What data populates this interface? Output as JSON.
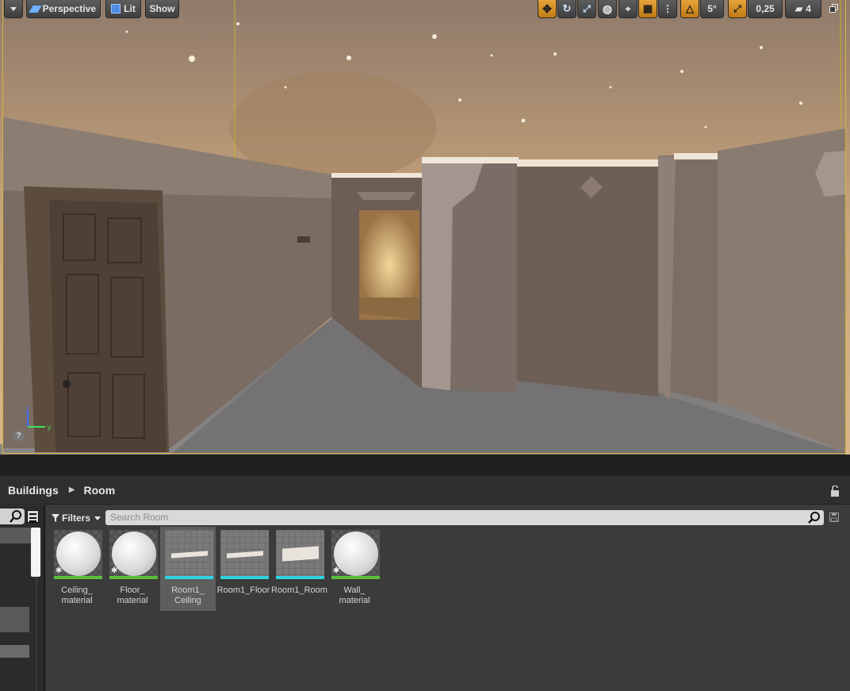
{
  "viewport": {
    "menu_button": "chevron-down",
    "view_mode": "Perspective",
    "lighting_mode": "Lit",
    "show_label": "Show",
    "rotation_snap": "5°",
    "scale_snap": "0,25",
    "camera_speed": "4",
    "axis_labels": {
      "z": "Z",
      "y": "Y"
    },
    "help_glyph": "?",
    "accent_color": "#d6a23a"
  },
  "content_browser": {
    "breadcrumb": [
      "Buildings",
      "Room"
    ],
    "filters_label": "Filters",
    "search_placeholder": "Search Room",
    "assets": [
      {
        "label": "Ceiling_\nmaterial",
        "kind": "material",
        "bar_color": "#5bbf3c",
        "selected": false
      },
      {
        "label": "Floor_\nmaterial",
        "kind": "material",
        "bar_color": "#5bbf3c",
        "selected": false
      },
      {
        "label": "Room1_\nCeiling",
        "kind": "mesh",
        "bar_color": "#2fd3e0",
        "selected": true
      },
      {
        "label": "Room1_Floor",
        "kind": "mesh",
        "bar_color": "#2fd3e0",
        "selected": false
      },
      {
        "label": "Room1_Room",
        "kind": "mesh",
        "bar_color": "#2fd3e0",
        "selected": false
      },
      {
        "label": "Wall_\nmaterial",
        "kind": "material",
        "bar_color": "#5bbf3c",
        "selected": false
      }
    ]
  }
}
